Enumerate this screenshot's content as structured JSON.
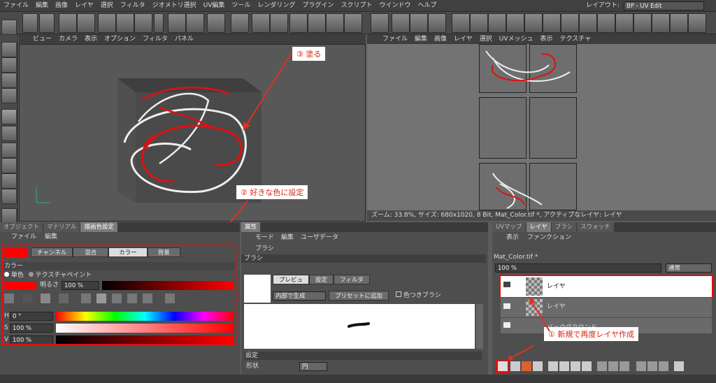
{
  "menu": [
    "ファイル",
    "編集",
    "画像",
    "レイヤ",
    "選択",
    "フィルタ",
    "ジオメトリ選択",
    "UV編集",
    "ツール",
    "レンダリング",
    "プラグイン",
    "スクリプト",
    "ウインドウ",
    "ヘルプ"
  ],
  "layout": {
    "label": "レイアウト:",
    "value": "BP - UV Edit"
  },
  "viewport_menu": [
    "ビュー",
    "カメラ",
    "表示",
    "オプション",
    "フィルタ",
    "パネル"
  ],
  "texture_menu": [
    "ファイル",
    "編集",
    "画像",
    "レイヤ",
    "選択",
    "UVメッシュ",
    "表示",
    "テクスチャ"
  ],
  "status_text": "ズーム: 33.8%, サイズ: 680x1020, 8 Bit, Mat_Color.tif *, アクティブなレイヤ: レイヤ",
  "left_panel": {
    "tabs": [
      "オブジェクト",
      "マテリアル",
      "描画色設定"
    ],
    "menu": [
      "ファイル",
      "編集"
    ],
    "sub_tabs": [
      "チャンネル",
      "混合",
      "カラー",
      "背景"
    ],
    "section": "カラー",
    "radio_single": "単色",
    "radio_texture": "テクスチャペイント",
    "brightness_label": "明るさ",
    "brightness_value": "100 %",
    "h_label": "H",
    "h_value": "0 °",
    "s_label": "S",
    "s_value": "100 %",
    "v_label": "V",
    "v_value": "100 %",
    "swatch_color": "#ff0000"
  },
  "attr_panel": {
    "title": "属性",
    "menu": [
      "モード",
      "編集",
      "ユーザデータ"
    ],
    "brush_label": "ブラシ",
    "section": "ブラシ",
    "sub_tabs": [
      "プレビュ",
      "設定",
      "フィルタ"
    ],
    "dropdown": "内部で生成",
    "preset_button": "プリセットに追加",
    "color_brush": "色つきブラシ",
    "settings_section": "設定",
    "shape_label": "形状",
    "shape_value": "円"
  },
  "layer_panel": {
    "tabs": [
      "UVマップ",
      "レイヤ",
      "ブラシ",
      "スウォッチ"
    ],
    "menu": [
      "表示",
      "ファンクション"
    ],
    "file_name": "Mat_Color.tif *",
    "opacity": "100 %",
    "blend": "通常",
    "layers": [
      "レイヤ",
      "レイヤ",
      "バックグラウンド"
    ]
  },
  "annotations": {
    "paint": "③ 塗る",
    "color": "② 好きな色に設定",
    "new_layer": "① 新規で再度レイヤ作成"
  },
  "colors": {
    "accent_red": "#e01010",
    "bg": "#5c5c5c",
    "panel": "#404040"
  }
}
